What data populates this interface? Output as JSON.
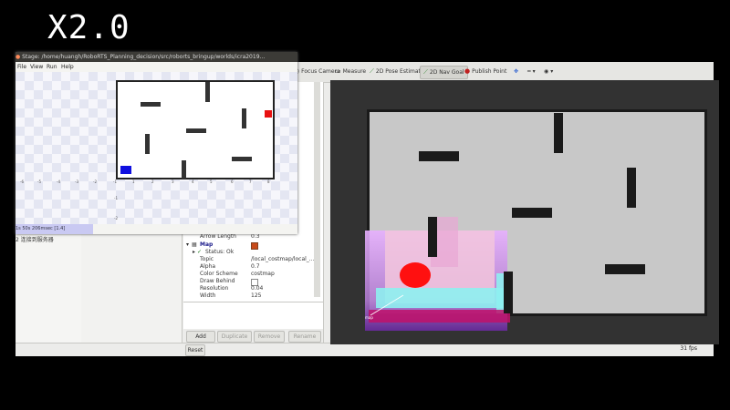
{
  "overlay": {
    "speed": "X2.0"
  },
  "rviz": {
    "toolbar": {
      "focus_camera": "Focus Camera",
      "measure": "Measure",
      "pose_estimate": "2D Pose Estimate",
      "nav_goal": "2D Nav Goal",
      "publish_point": "Publish Point"
    },
    "props": {
      "arrow_length_key": "Arrow Length",
      "arrow_length_val": "0.3",
      "map_key": "Map",
      "status_key": "Status: Ok",
      "topic_key": "Topic",
      "topic_val": "/local_costmap/local_...",
      "alpha_key": "Alpha",
      "alpha_val": "0.7",
      "color_key": "Color Scheme",
      "color_val": "costmap",
      "draw_key": "Draw Behind",
      "res_key": "Resolution",
      "res_val": "0.04",
      "width_key": "Width",
      "width_val": "125"
    },
    "buttons": {
      "add": "Add",
      "duplicate": "Duplicate",
      "remove": "Remove",
      "rename": "Rename"
    },
    "reset": "Reset",
    "fps": "31 fps",
    "connect_text": "2  连接到服务器"
  },
  "stage": {
    "title": "Stage: /home/huangh/RoboRTS_Planning_decision/src/roborts_bringup/worlds/icra2019...",
    "menu": {
      "file": "File",
      "view": "View",
      "run": "Run",
      "help": "Help"
    },
    "ticks_x": [
      "-6",
      "-5",
      "-4",
      "-3",
      "-2",
      "-1",
      "1",
      "2",
      "3",
      "4",
      "5",
      "6",
      "7",
      "8"
    ],
    "ticks_y": [
      "-1",
      "-2"
    ],
    "footer": "1s 50s 206msec [1.4]"
  },
  "colors": {
    "robot_red": "#e81010",
    "robot_blue": "#1010e0",
    "map_bg": "#c8c8c8",
    "obstacle": "#1a1a1a"
  }
}
